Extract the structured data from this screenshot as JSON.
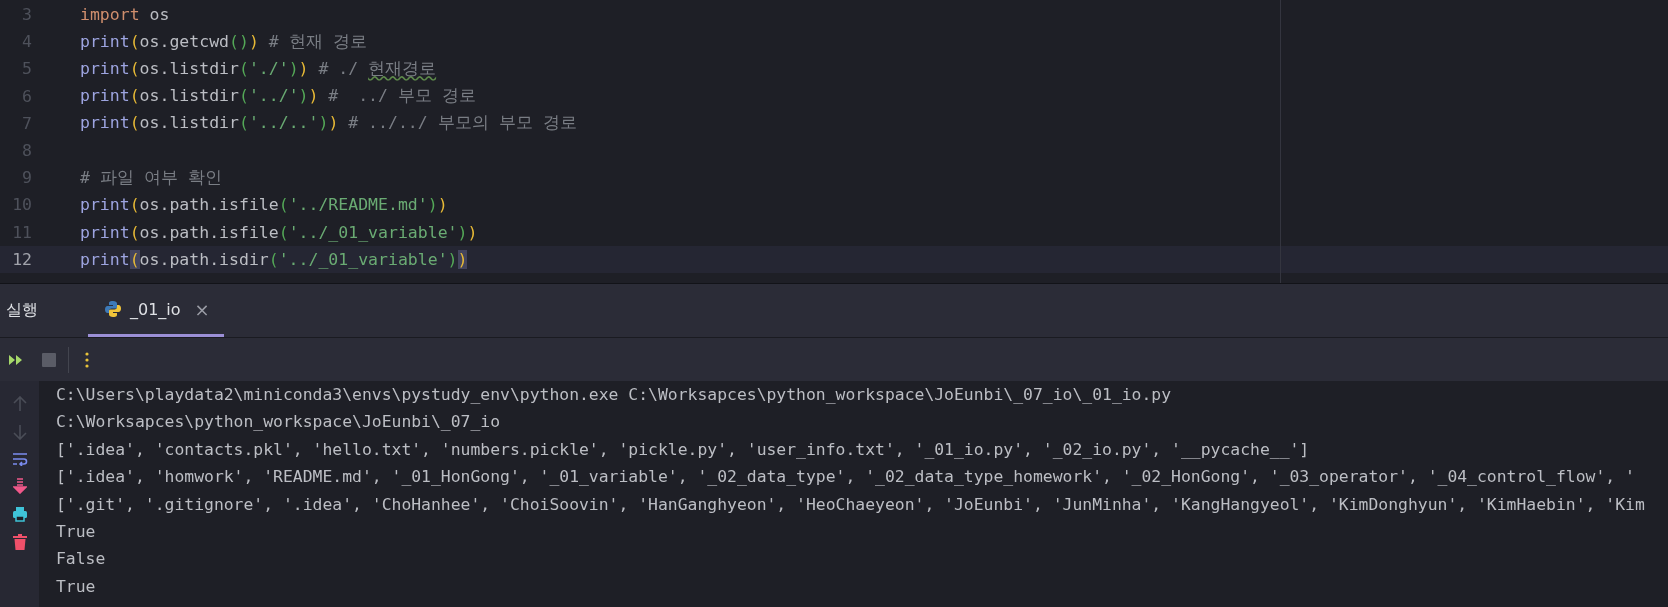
{
  "editor": {
    "lines": [
      {
        "number": "3",
        "current": false,
        "tokens": [
          {
            "kind": "keyword",
            "text": "import"
          },
          {
            "kind": "plain",
            "text": " os"
          }
        ]
      },
      {
        "number": "4",
        "current": false,
        "tokens": [
          {
            "kind": "builtin",
            "text": "print"
          },
          {
            "kind": "bracket",
            "text": "("
          },
          {
            "kind": "plain",
            "text": "os.getcwd"
          },
          {
            "kind": "bracket2",
            "text": "()"
          },
          {
            "kind": "bracket",
            "text": ")"
          },
          {
            "kind": "comment",
            "text": " # 현재 경로"
          }
        ]
      },
      {
        "number": "5",
        "current": false,
        "tokens": [
          {
            "kind": "builtin",
            "text": "print"
          },
          {
            "kind": "bracket",
            "text": "("
          },
          {
            "kind": "plain",
            "text": "os.listdir"
          },
          {
            "kind": "bracket2",
            "text": "("
          },
          {
            "kind": "string",
            "text": "'./'"
          },
          {
            "kind": "bracket2",
            "text": ")"
          },
          {
            "kind": "bracket",
            "text": ")"
          },
          {
            "kind": "comment",
            "text": " # ./ "
          },
          {
            "kind": "typo",
            "text": "현재경로"
          }
        ]
      },
      {
        "number": "6",
        "current": false,
        "tokens": [
          {
            "kind": "builtin",
            "text": "print"
          },
          {
            "kind": "bracket",
            "text": "("
          },
          {
            "kind": "plain",
            "text": "os.listdir"
          },
          {
            "kind": "bracket2",
            "text": "("
          },
          {
            "kind": "string",
            "text": "'../'"
          },
          {
            "kind": "bracket2",
            "text": ")"
          },
          {
            "kind": "bracket",
            "text": ")"
          },
          {
            "kind": "comment",
            "text": " #  ../ 부모 경로"
          }
        ]
      },
      {
        "number": "7",
        "current": false,
        "tokens": [
          {
            "kind": "builtin",
            "text": "print"
          },
          {
            "kind": "bracket",
            "text": "("
          },
          {
            "kind": "plain",
            "text": "os.listdir"
          },
          {
            "kind": "bracket2",
            "text": "("
          },
          {
            "kind": "string",
            "text": "'../..'"
          },
          {
            "kind": "bracket2",
            "text": ")"
          },
          {
            "kind": "bracket",
            "text": ")"
          },
          {
            "kind": "comment",
            "text": " # ../../ 부모의 부모 경로"
          }
        ]
      },
      {
        "number": "8",
        "current": false
      },
      {
        "number": "9",
        "current": false,
        "tokens": [
          {
            "kind": "comment",
            "text": "# 파일 여부 확인"
          }
        ]
      },
      {
        "number": "10",
        "current": false,
        "tokens": [
          {
            "kind": "builtin",
            "text": "print"
          },
          {
            "kind": "bracket",
            "text": "("
          },
          {
            "kind": "plain",
            "text": "os.path.isfile"
          },
          {
            "kind": "bracket2",
            "text": "("
          },
          {
            "kind": "string",
            "text": "'../README.md'"
          },
          {
            "kind": "bracket2",
            "text": ")"
          },
          {
            "kind": "bracket",
            "text": ")"
          }
        ]
      },
      {
        "number": "11",
        "current": false,
        "tokens": [
          {
            "kind": "builtin",
            "text": "print"
          },
          {
            "kind": "bracket",
            "text": "("
          },
          {
            "kind": "plain",
            "text": "os.path.isfile"
          },
          {
            "kind": "bracket2",
            "text": "("
          },
          {
            "kind": "string",
            "text": "'../_01_variable'"
          },
          {
            "kind": "bracket2",
            "text": ")"
          },
          {
            "kind": "bracket",
            "text": ")"
          }
        ]
      },
      {
        "number": "12",
        "current": true,
        "tokens": [
          {
            "kind": "builtin",
            "text": "print"
          },
          {
            "kind": "matched",
            "text": "("
          },
          {
            "kind": "plain",
            "text": "os.path.isdir"
          },
          {
            "kind": "bracket2",
            "text": "("
          },
          {
            "kind": "string",
            "text": "'../_01_variable'"
          },
          {
            "kind": "bracket2",
            "text": ")"
          },
          {
            "kind": "matched",
            "text": ")"
          }
        ]
      }
    ]
  },
  "run_panel": {
    "title": "실행",
    "tabs": [
      {
        "label": "_01_io",
        "selected": true,
        "close": "×"
      }
    ]
  },
  "console": {
    "lines": [
      "C:\\Users\\playdata2\\miniconda3\\envs\\pystudy_env\\python.exe C:\\Worksapces\\python_workspace\\JoEunbi\\_07_io\\_01_io.py",
      "C:\\Worksapces\\python_workspace\\JoEunbi\\_07_io",
      "['.idea', 'contacts.pkl', 'hello.txt', 'numbers.pickle', 'pickle.py', 'user_info.txt', '_01_io.py', '_02_io.py', '__pycache__']",
      "['.idea', 'homwork', 'README.md', '_01_HonGong', '_01_variable', '_02_data_type', '_02_data_type_homework', '_02_HonGong', '_03_operator', '_04_control_flow', '",
      "['.git', '.gitignore', '.idea', 'ChoHanhee', 'ChoiSoovin', 'HanGanghyeon', 'HeoChaeyeon', 'JoEunbi', 'JunMinha', 'KangHangyeol', 'KimDonghyun', 'KimHaebin', 'Kim",
      "True",
      "False",
      "True"
    ]
  }
}
